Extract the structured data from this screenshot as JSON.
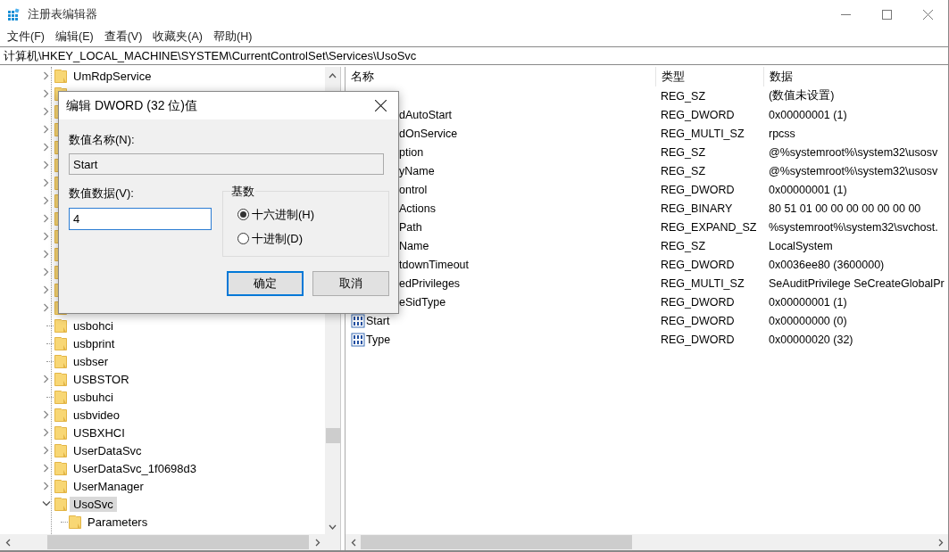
{
  "window": {
    "title": "注册表编辑器"
  },
  "menu": [
    {
      "label": "文件(F)"
    },
    {
      "label": "编辑(E)"
    },
    {
      "label": "查看(V)"
    },
    {
      "label": "收藏夹(A)"
    },
    {
      "label": "帮助(H)"
    }
  ],
  "address": "计算机\\HKEY_LOCAL_MACHINE\\SYSTEM\\CurrentControlSet\\Services\\UsoSvc",
  "tree": [
    {
      "kind": "key",
      "label": "UmRdpService",
      "expandable": true,
      "expanded": false,
      "selected": false
    },
    {
      "kind": "covered",
      "expandable": true,
      "expanded": false
    },
    {
      "kind": "covered",
      "expandable": true,
      "expanded": false
    },
    {
      "kind": "covered",
      "expandable": true,
      "expanded": false
    },
    {
      "kind": "covered",
      "expandable": true,
      "expanded": false
    },
    {
      "kind": "covered",
      "expandable": true,
      "expanded": false
    },
    {
      "kind": "covered",
      "expandable": true,
      "expanded": false
    },
    {
      "kind": "covered",
      "expandable": true,
      "expanded": false
    },
    {
      "kind": "covered",
      "expandable": true,
      "expanded": false
    },
    {
      "kind": "covered",
      "expandable": true,
      "expanded": false
    },
    {
      "kind": "covered",
      "expandable": true,
      "expanded": false
    },
    {
      "kind": "covered",
      "expandable": true,
      "expanded": false
    },
    {
      "kind": "covered",
      "expandable": true,
      "expanded": false
    },
    {
      "kind": "covered",
      "expandable": true,
      "expanded": false
    },
    {
      "kind": "key",
      "label": "usbohci",
      "expandable": false,
      "selected": false
    },
    {
      "kind": "key",
      "label": "usbprint",
      "expandable": false,
      "selected": false
    },
    {
      "kind": "key",
      "label": "usbser",
      "expandable": false,
      "selected": false
    },
    {
      "kind": "key",
      "label": "USBSTOR",
      "expandable": true,
      "expanded": false,
      "selected": false
    },
    {
      "kind": "key",
      "label": "usbuhci",
      "expandable": false,
      "selected": false
    },
    {
      "kind": "key",
      "label": "usbvideo",
      "expandable": true,
      "expanded": false,
      "selected": false
    },
    {
      "kind": "key",
      "label": "USBXHCI",
      "expandable": true,
      "expanded": false,
      "selected": false
    },
    {
      "kind": "key",
      "label": "UserDataSvc",
      "expandable": true,
      "expanded": false,
      "selected": false
    },
    {
      "kind": "key",
      "label": "UserDataSvc_1f0698d3",
      "expandable": true,
      "expanded": false,
      "selected": false
    },
    {
      "kind": "key",
      "label": "UserManager",
      "expandable": true,
      "expanded": false,
      "selected": false
    },
    {
      "kind": "key",
      "label": "UsoSvc",
      "expandable": true,
      "expanded": true,
      "selected": true,
      "children": [
        {
          "kind": "key",
          "label": "Parameters",
          "expandable": false,
          "selected": false
        }
      ]
    }
  ],
  "list": {
    "columns": [
      "名称",
      "类型",
      "数据"
    ],
    "rows": [
      {
        "kind": "covered",
        "type": "REG_SZ",
        "data": "(数值未设置)"
      },
      {
        "kind": "covered",
        "name": "dAutoStart",
        "type": "REG_DWORD",
        "data": "0x00000001 (1)"
      },
      {
        "kind": "covered",
        "name": "dOnService",
        "type": "REG_MULTI_SZ",
        "data": "rpcss"
      },
      {
        "kind": "covered",
        "name": "ption",
        "type": "REG_SZ",
        "data": "@%systemroot%\\system32\\usosv"
      },
      {
        "kind": "covered",
        "name": "yName",
        "type": "REG_SZ",
        "data": "@%systemroot%\\system32\\usosv"
      },
      {
        "kind": "covered",
        "name": "ontrol",
        "type": "REG_DWORD",
        "data": "0x00000001 (1)"
      },
      {
        "kind": "covered",
        "name": "Actions",
        "type": "REG_BINARY",
        "data": "80 51 01 00 00 00 00 00 00 00"
      },
      {
        "kind": "covered",
        "name": "Path",
        "type": "REG_EXPAND_SZ",
        "data": "%systemroot%\\system32\\svchost."
      },
      {
        "kind": "covered",
        "name": "Name",
        "type": "REG_SZ",
        "data": "LocalSystem"
      },
      {
        "kind": "covered",
        "name": "tdownTimeout",
        "type": "REG_DWORD",
        "data": "0x0036ee80 (3600000)"
      },
      {
        "kind": "covered",
        "name": "edPrivileges",
        "type": "REG_MULTI_SZ",
        "data": "SeAuditPrivilege SeCreateGlobalPr"
      },
      {
        "kind": "covered",
        "name": "eSidType",
        "type": "REG_DWORD",
        "data": "0x00000001 (1)"
      },
      {
        "kind": "dword",
        "name": "Start",
        "type": "REG_DWORD",
        "data": "0x00000000 (0)"
      },
      {
        "kind": "dword",
        "name": "Type",
        "type": "REG_DWORD",
        "data": "0x00000020 (32)"
      }
    ]
  },
  "dialog": {
    "title": "编辑 DWORD (32 位)值",
    "name_label": "数值名称(N):",
    "name_value": "Start",
    "data_label": "数值数据(V):",
    "data_value": "4",
    "base_label": "基数",
    "radios": [
      {
        "label": "十六进制(H)",
        "selected": true
      },
      {
        "label": "十进制(D)",
        "selected": false
      }
    ],
    "buttons": [
      {
        "label": "确定",
        "default": true
      },
      {
        "label": "取消",
        "default": false
      }
    ]
  }
}
